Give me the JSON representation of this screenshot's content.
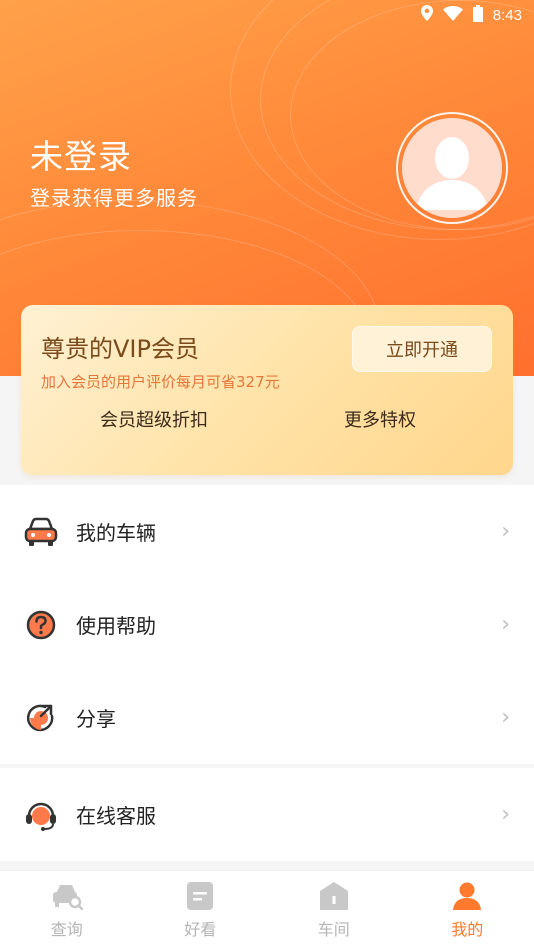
{
  "status_bar": {
    "time": "8:43",
    "icons": [
      "location-icon",
      "wifi-icon",
      "battery-icon"
    ]
  },
  "profile": {
    "title": "未登录",
    "subtitle": "登录获得更多服务"
  },
  "vip": {
    "title": "尊贵的VIP会员",
    "description": "加入会员的用户评价每月可省327元",
    "button_label": "立即开通",
    "perks": [
      "会员超级折扣",
      "更多特权"
    ]
  },
  "menu": {
    "items": [
      {
        "label": "我的车辆",
        "icon": "car-icon"
      },
      {
        "label": "使用帮助",
        "icon": "help-icon"
      },
      {
        "label": "分享",
        "icon": "share-icon"
      }
    ],
    "support": {
      "label": "在线客服",
      "icon": "headset-icon"
    }
  },
  "tabs": [
    {
      "label": "查询",
      "icon": "car-search-icon",
      "active": false
    },
    {
      "label": "好看",
      "icon": "document-icon",
      "active": false
    },
    {
      "label": "车间",
      "icon": "garage-icon",
      "active": false
    },
    {
      "label": "我的",
      "icon": "person-icon",
      "active": true
    }
  ],
  "colors": {
    "accent": "#ff7a2e",
    "header_start": "#ffa14a",
    "header_end": "#ff6f2e",
    "vip_text": "#7a4a1a"
  }
}
